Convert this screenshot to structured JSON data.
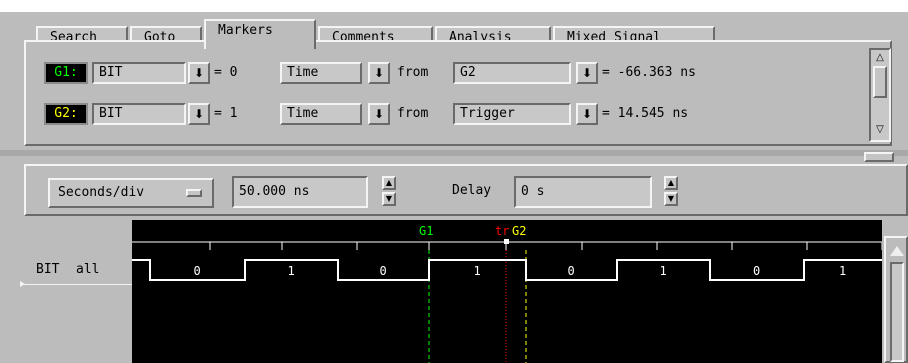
{
  "tabs": [
    {
      "label": "Search"
    },
    {
      "label": "Goto"
    },
    {
      "label": "Markers",
      "active": true
    },
    {
      "label": "Comments"
    },
    {
      "label": "Analysis"
    },
    {
      "label": "Mixed Signal"
    }
  ],
  "markers": [
    {
      "name": "G1:",
      "color": "#00ff00",
      "signal": "BIT",
      "eq": "= 0",
      "mode": "Time",
      "from": "from",
      "ref": "G2",
      "result": "= -66.363 ns"
    },
    {
      "name": "G2:",
      "color": "#ffff00",
      "signal": "BIT",
      "eq": "= 1",
      "mode": "Time",
      "from": "from",
      "ref": "Trigger",
      "result": "= 14.545 ns"
    }
  ],
  "toolbar": {
    "scale_label": "Seconds/div",
    "scale_value": "50.000 ns",
    "delay_label": "Delay",
    "delay_value": "0 s"
  },
  "waveform": {
    "marker_g1": "G1",
    "marker_trigger": "tr",
    "marker_g2": "G2",
    "g1_color": "#00ff00",
    "g2_color": "#ffff00",
    "trigger_color": "#ff0000",
    "signal_name": "BIT",
    "signal_bus": "all",
    "values": [
      "0",
      "1",
      "0",
      "1",
      "0",
      "1",
      "0",
      "1"
    ]
  },
  "icons": {
    "dropdown": "down-arrow-icon",
    "spin_up": "up-arrow-icon",
    "spin_down": "down-arrow-icon"
  }
}
